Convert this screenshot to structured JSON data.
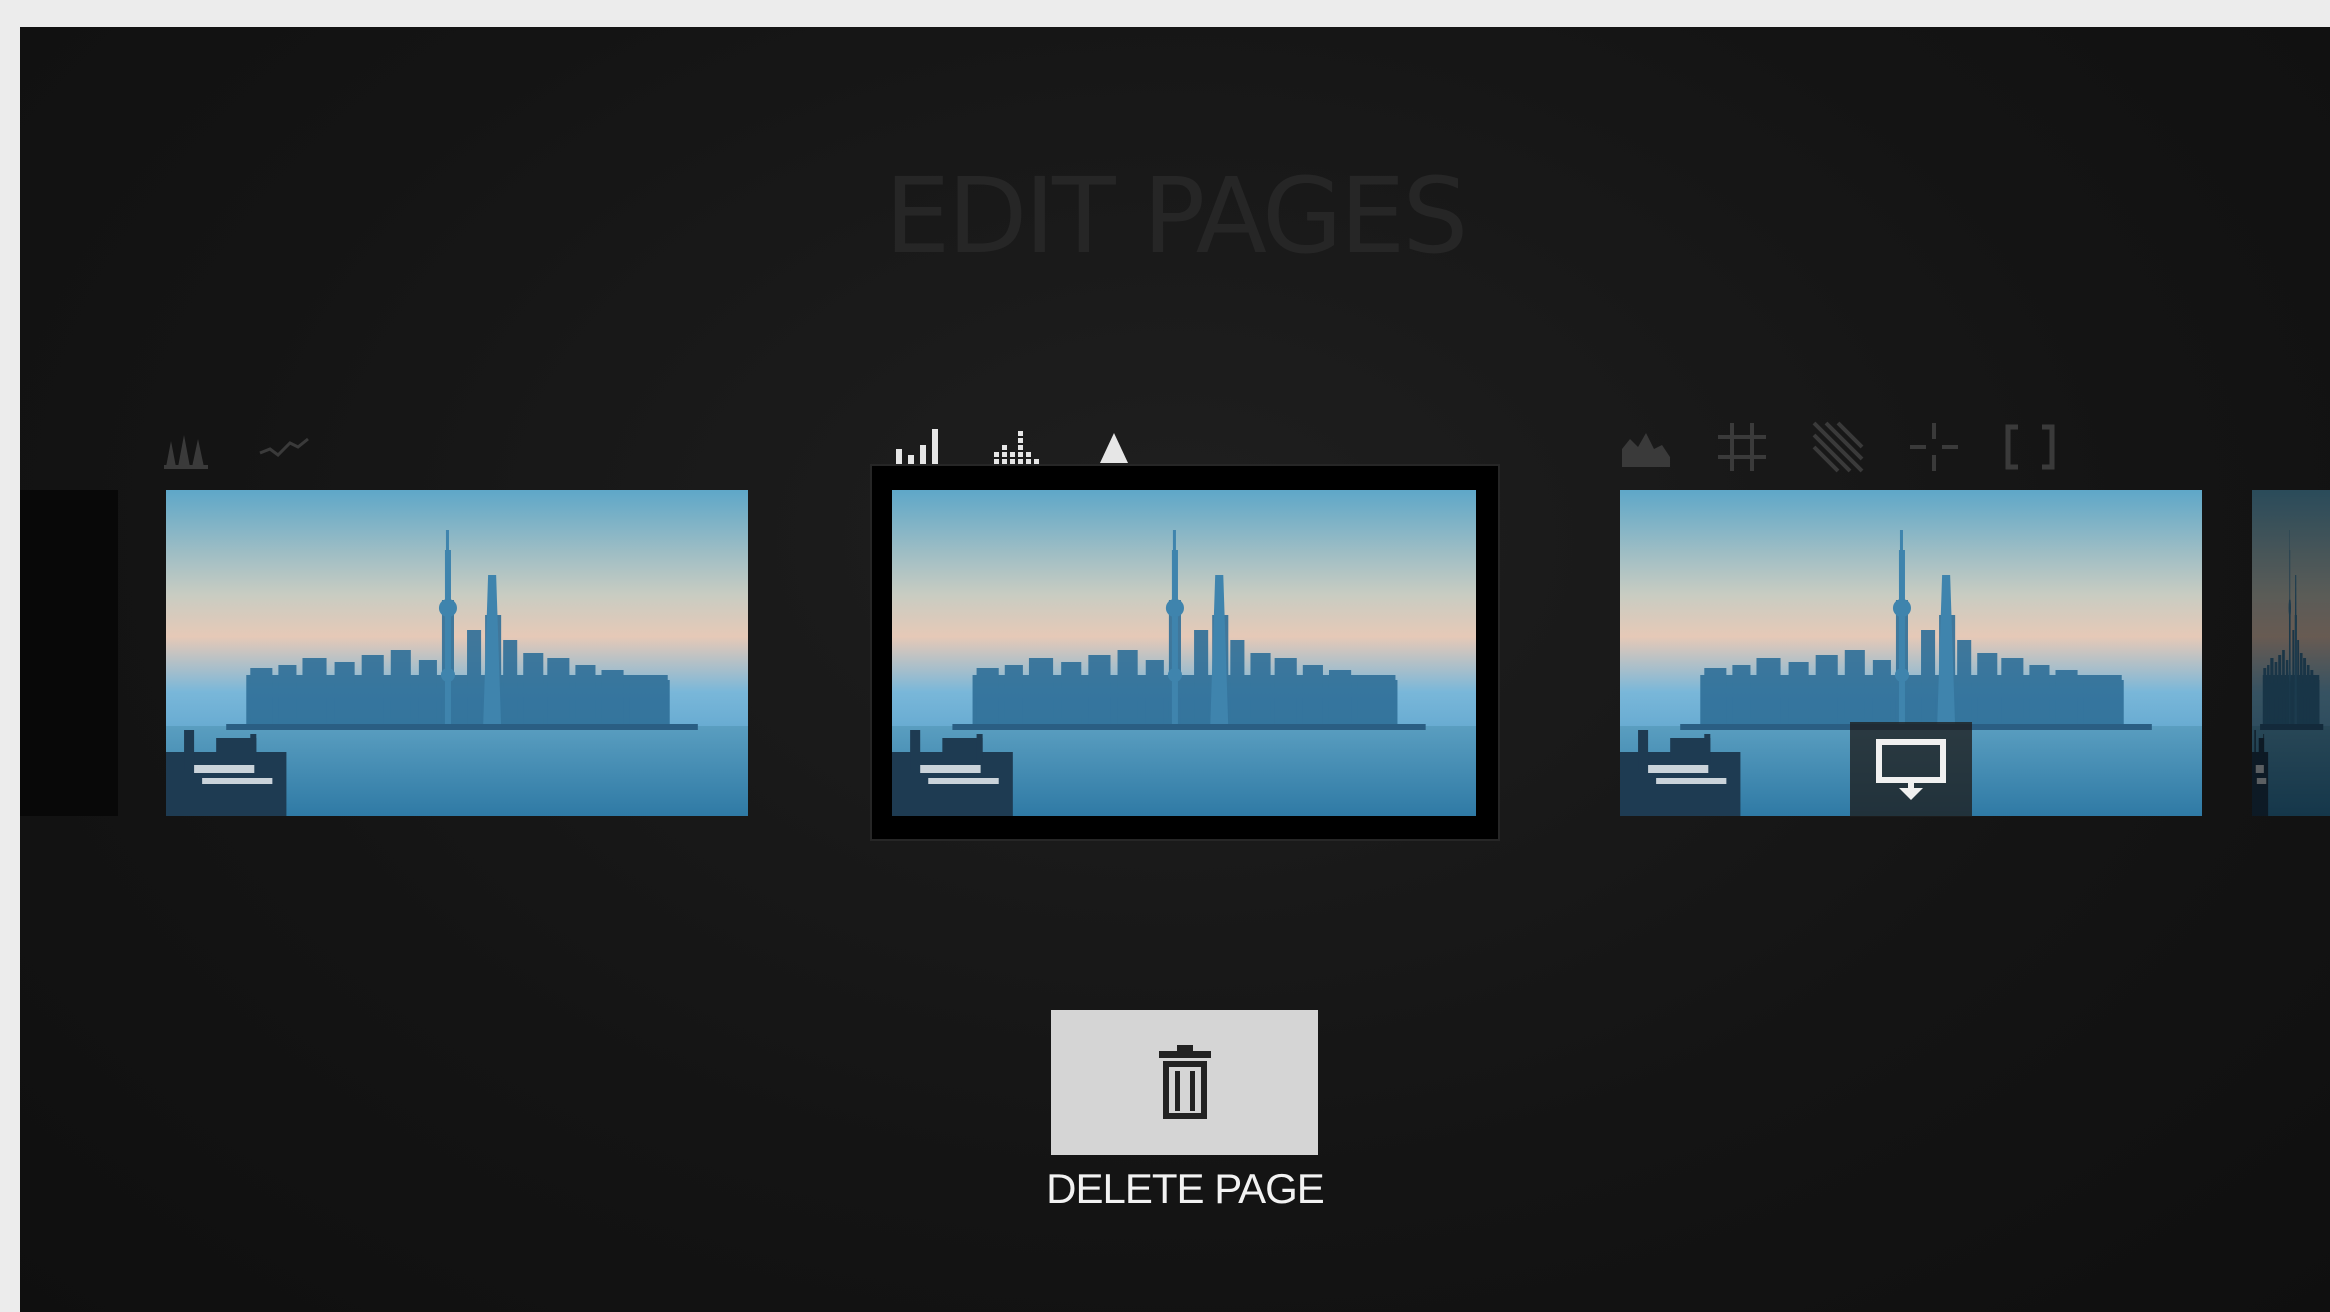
{
  "screen": {
    "title": "EDIT PAGES"
  },
  "left_page": {
    "icons": [
      "trees-icon",
      "line-wave-icon"
    ]
  },
  "center_page": {
    "icons": [
      "bar-chart-icon",
      "dot-bar-chart-icon",
      "triangle-icon"
    ],
    "selected": true
  },
  "right_page": {
    "icons": [
      "mountain-chart-icon",
      "grid-hash-icon",
      "diagonal-stripes-icon",
      "crosshair-icon",
      "brackets-icon"
    ],
    "overlay_icon": "present-monitor-icon"
  },
  "delete": {
    "label": "DELETE PAGE",
    "icon": "trash-icon"
  },
  "colors": {
    "background": "#141414",
    "dim_icon": "#3a3a3a",
    "active_icon": "#e6e6e6",
    "button_bg": "#d5d5d5",
    "button_icon": "#222222",
    "label": "#f2f2f2"
  }
}
